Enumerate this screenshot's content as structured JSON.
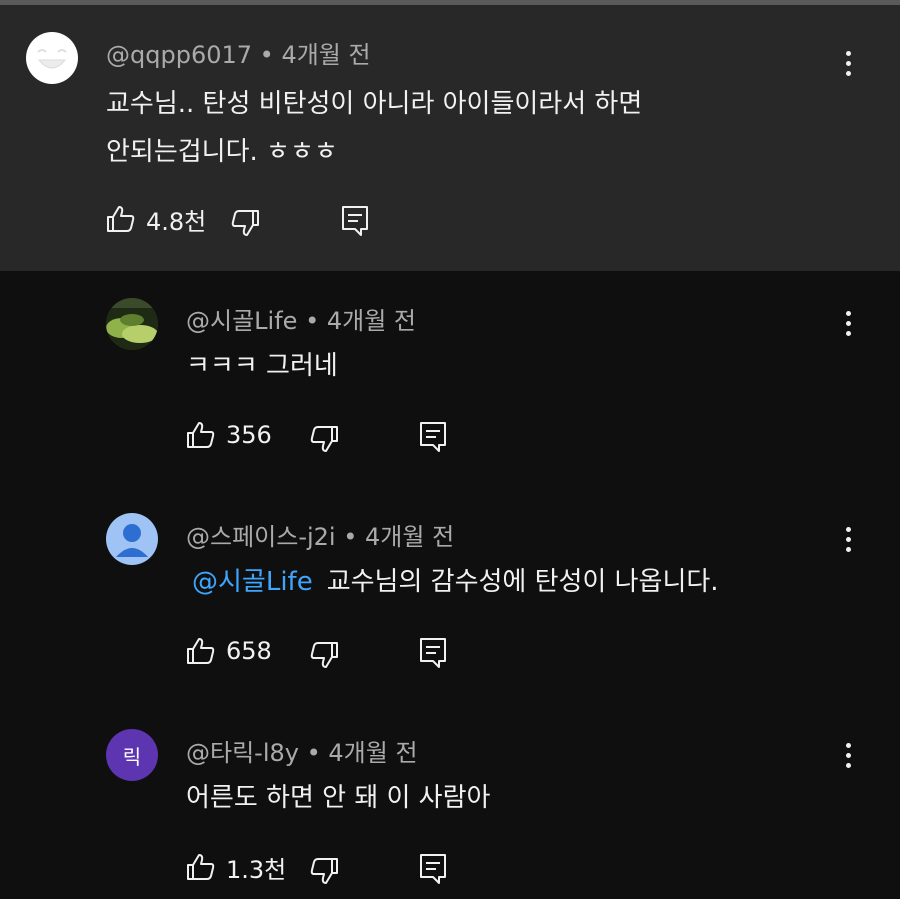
{
  "colors": {
    "background": "#0f0f0f",
    "highlight_background": "#282828",
    "meta_text": "#aaaaaa",
    "mention": "#3ea6ff"
  },
  "comments": [
    {
      "author": "@qqpp6017",
      "time": "4개월 전",
      "lines": [
        "교수님.. 탄성 비탄성이 아니라 아이들이라서 하면",
        "안되는겁니다. ㅎㅎㅎ"
      ],
      "likes": "4.8천",
      "avatar": "smiley-face-icon"
    },
    {
      "author": "@시골Life",
      "time": "4개월 전",
      "text": "ㅋㅋㅋ 그러네",
      "likes": "356",
      "avatar": "landscape-photo"
    },
    {
      "author": "@스페이스-j2i",
      "time": "4개월 전",
      "mention": "@시골Life",
      "text": "교수님의 감수성에 탄성이 나옵니다.",
      "likes": "658",
      "avatar": "default-user-icon"
    },
    {
      "author": "@타릭-l8y",
      "time": "4개월 전",
      "text": "어른도 하면 안 돼 이 사람아",
      "likes": "1.3천",
      "avatar_letter": "릭",
      "avatar_color": "#5e35b1"
    }
  ],
  "icons": {
    "like": "thumbs-up-icon",
    "dislike": "thumbs-down-icon",
    "reply": "reply-icon",
    "menu": "more-vert-icon"
  }
}
